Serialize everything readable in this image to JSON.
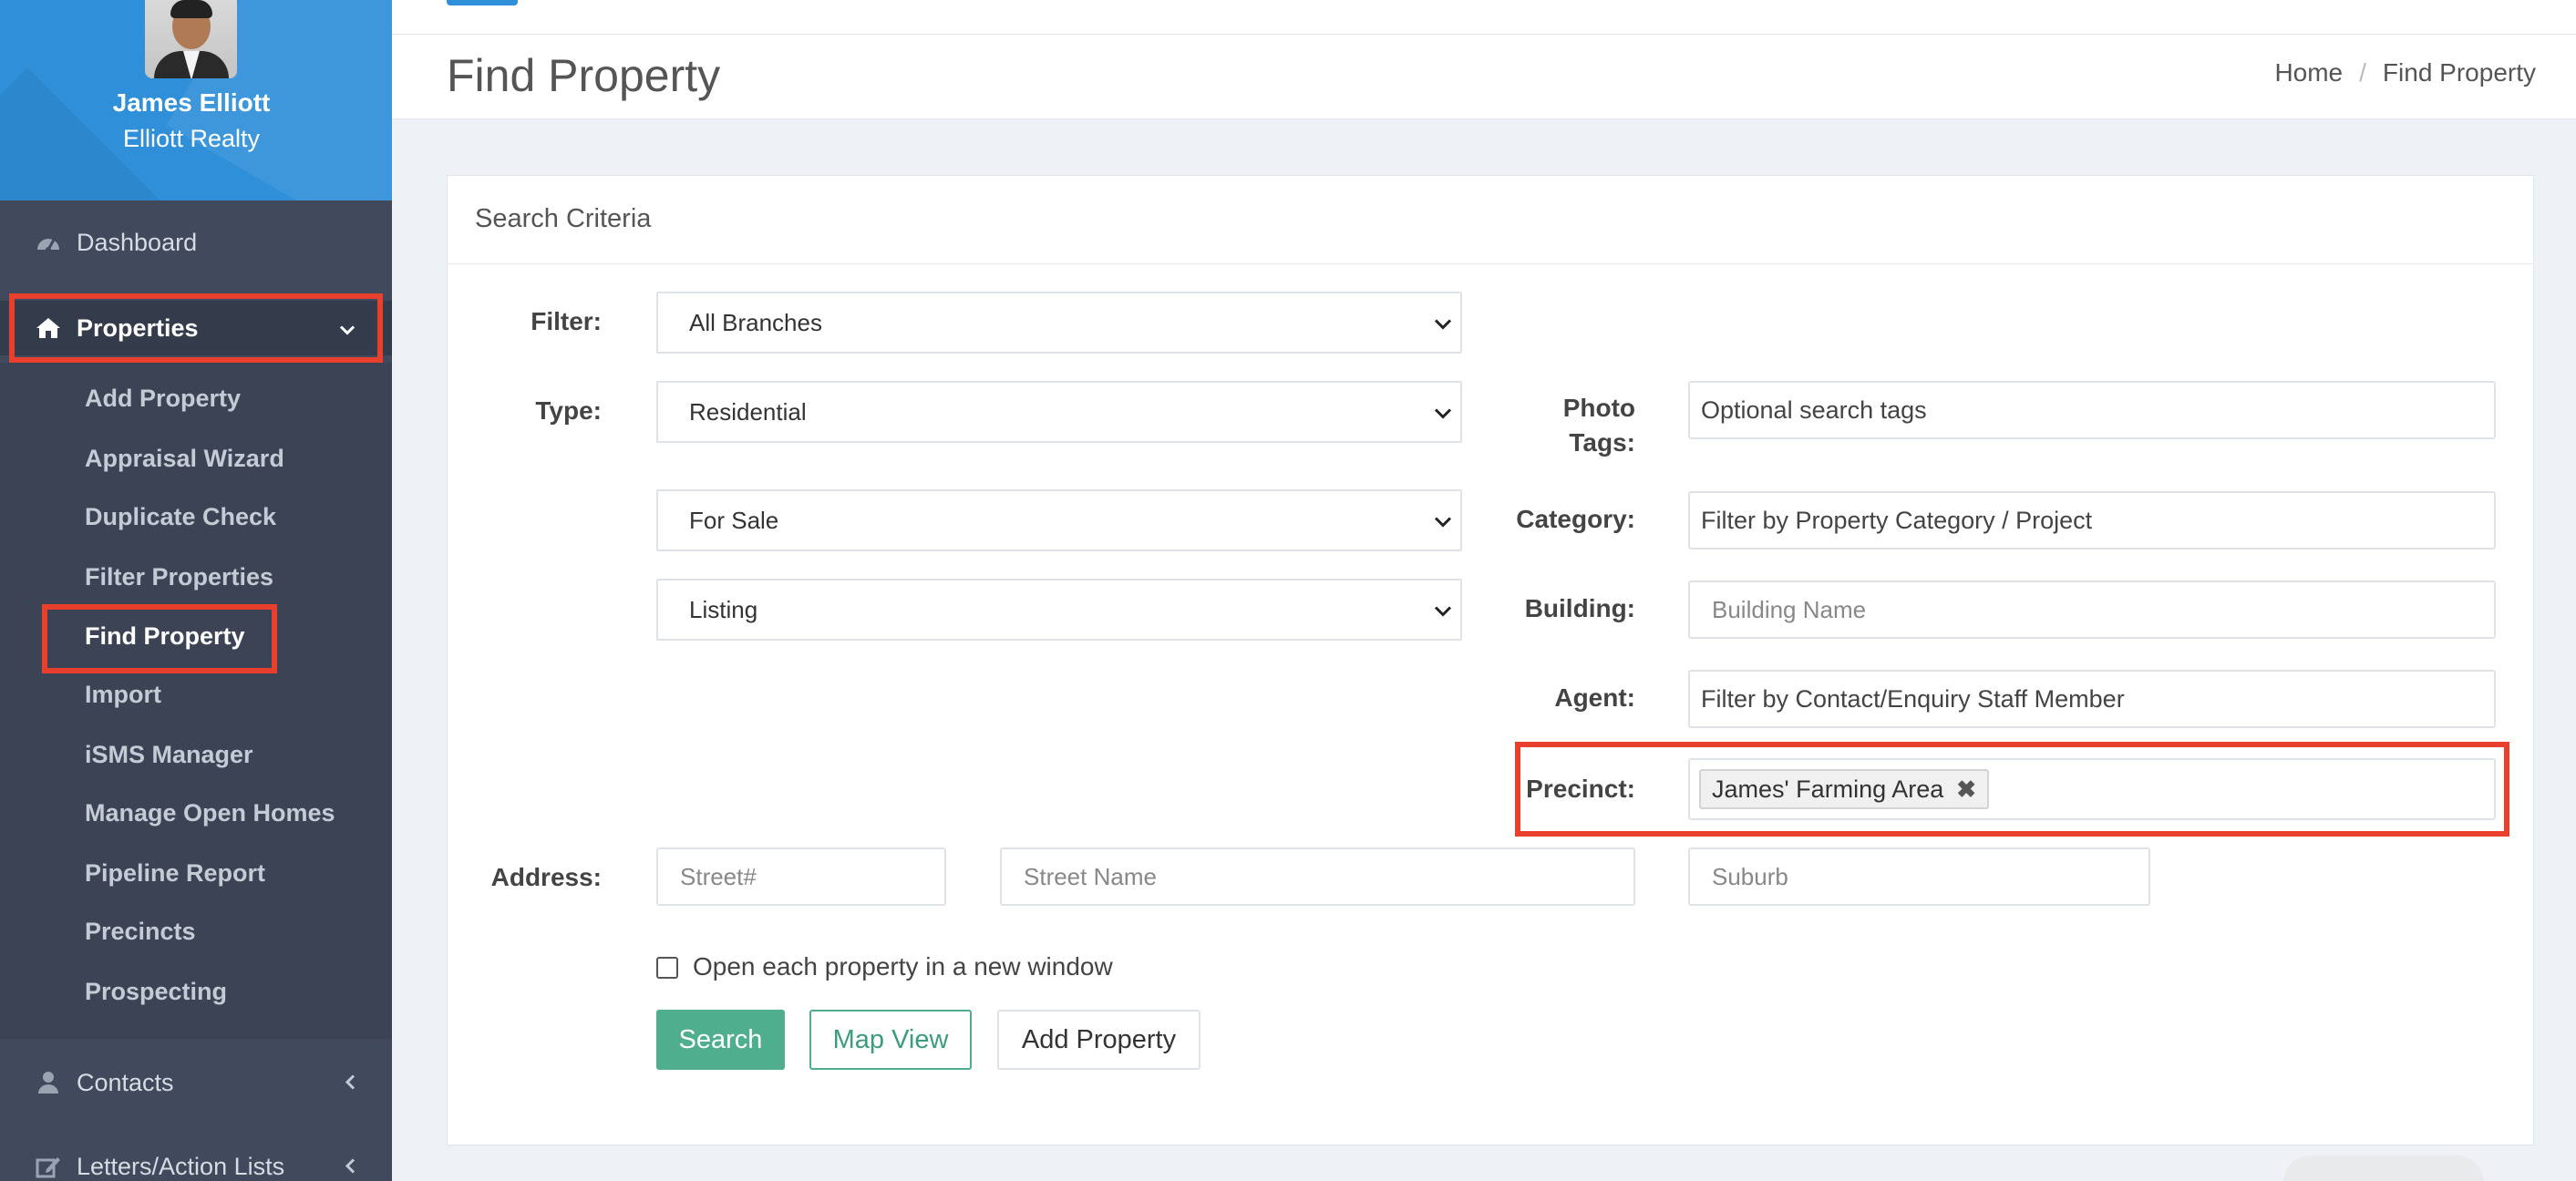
{
  "profile": {
    "name": "James Elliott",
    "company": "Elliott Realty"
  },
  "nav": {
    "dashboard": "Dashboard",
    "properties": "Properties",
    "submenu": [
      "Add Property",
      "Appraisal Wizard",
      "Duplicate Check",
      "Filter Properties",
      "Find Property",
      "Import",
      "iSMS Manager",
      "Manage Open Homes",
      "Pipeline Report",
      "Precincts",
      "Prospecting"
    ],
    "contacts": "Contacts",
    "letters": "Letters/Action Lists"
  },
  "page": {
    "title": "Find Property"
  },
  "breadcrumb": {
    "home": "Home",
    "separator": "/",
    "current": "Find Property"
  },
  "panel": {
    "title": "Search Criteria"
  },
  "form": {
    "filter_label": "Filter:",
    "filter_value": "All Branches",
    "type_label": "Type:",
    "type_value": "Residential",
    "sale_value": "For Sale",
    "listing_value": "Listing",
    "photo_tags_label_1": "Photo",
    "photo_tags_label_2": "Tags:",
    "photo_tags_placeholder": "Optional search tags",
    "category_label": "Category:",
    "category_placeholder": "Filter by Property Category / Project",
    "building_label": "Building:",
    "building_placeholder": "Building Name",
    "agent_label": "Agent:",
    "agent_placeholder": "Filter by Contact/Enquiry Staff Member",
    "precinct_label": "Precinct:",
    "precinct_tag": "James' Farming Area",
    "address_label": "Address:",
    "street_num_placeholder": "Street#",
    "street_name_placeholder": "Street Name",
    "suburb_placeholder": "Suburb",
    "new_window_label": "Open each property in a new window"
  },
  "buttons": {
    "search": "Search",
    "map_view": "Map View",
    "add_property": "Add Property"
  },
  "colors": {
    "accent_blue": "#2f8fd8",
    "sidebar": "#414a5d",
    "highlight": "#e8402c",
    "primary_green": "#4eae8d"
  },
  "icons": [
    "dashboard-icon",
    "home-icon",
    "chevron-down-icon",
    "user-icon",
    "edit-icon",
    "chevron-left-icon",
    "caret-down-icon",
    "remove-tag-icon"
  ]
}
